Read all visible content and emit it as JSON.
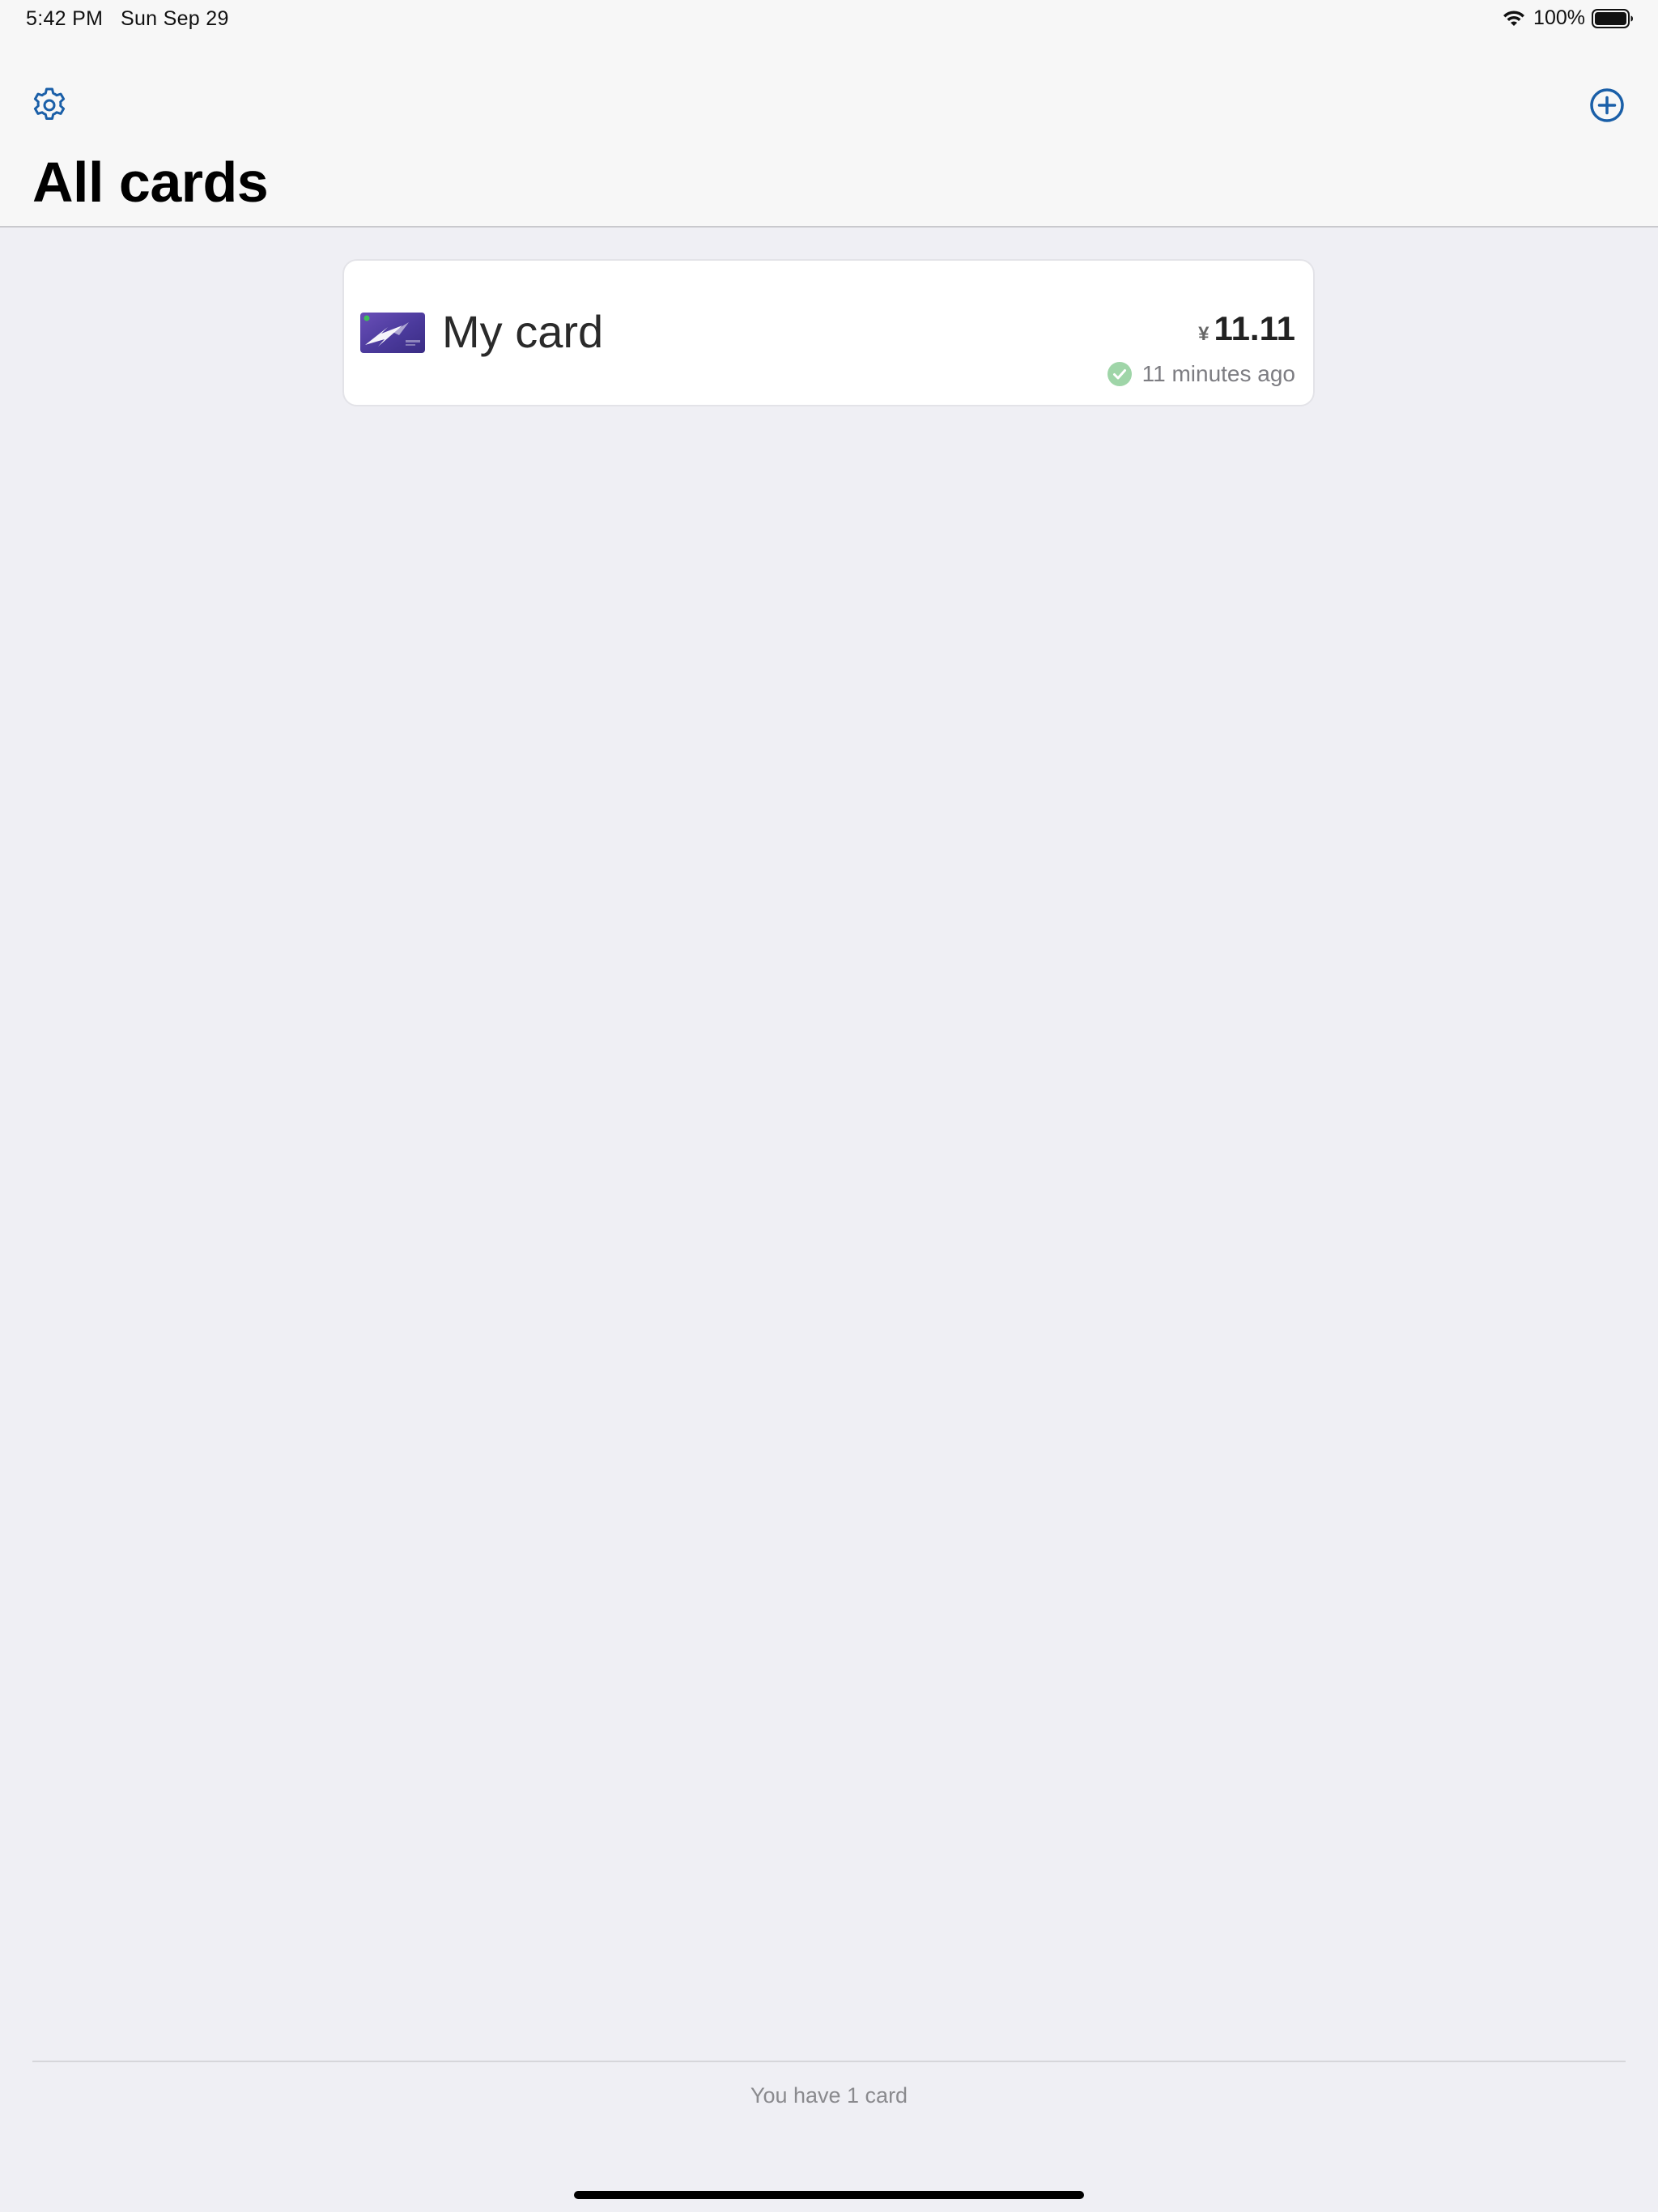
{
  "status_bar": {
    "time": "5:42 PM",
    "date": "Sun Sep 29",
    "battery_percent": "100%",
    "battery_level": 1.0,
    "icons": [
      "wifi-icon",
      "battery-icon"
    ]
  },
  "nav": {
    "title": "All cards",
    "left_icon": "gear-icon",
    "right_icon": "plus-circle-icon",
    "accent_color": "#1a5fa8"
  },
  "cards": [
    {
      "name": "My card",
      "currency": "¥",
      "balance": "11.11",
      "status_text": "11 minutes ago",
      "status_icon": "check-circle-icon",
      "status_color": "#9fd5a8"
    }
  ],
  "footer": {
    "summary": "You have 1 card"
  }
}
